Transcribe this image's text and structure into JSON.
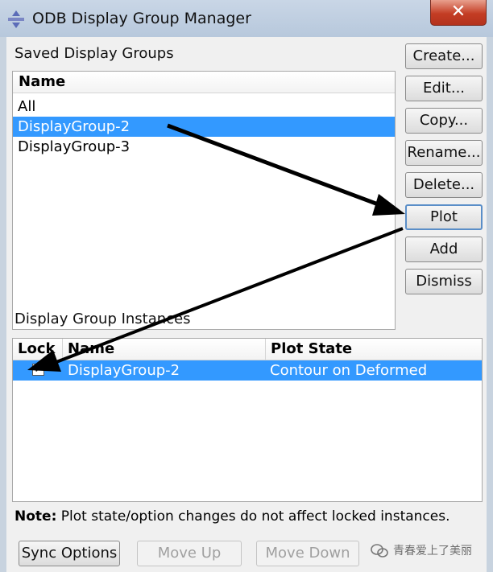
{
  "window": {
    "title": "ODB Display Group Manager",
    "close_glyph": "✕"
  },
  "saved": {
    "section_label": "Saved Display Groups",
    "column_header": "Name",
    "items": [
      "All",
      "DisplayGroup-2",
      "DisplayGroup-3"
    ],
    "selected_index": 1
  },
  "buttons": {
    "create": "Create...",
    "edit": "Edit...",
    "copy": "Copy...",
    "rename": "Rename...",
    "delete": "Delete...",
    "plot": "Plot",
    "add": "Add",
    "dismiss": "Dismiss"
  },
  "instances": {
    "section_label": "Display Group Instances",
    "headers": {
      "lock": "Lock",
      "name": "Name",
      "plot_state": "Plot State"
    },
    "rows": [
      {
        "locked": true,
        "check_glyph": "✓",
        "name": "DisplayGroup-2",
        "plot_state": "Contour on Deformed"
      }
    ]
  },
  "note": {
    "prefix": "Note:",
    "text": "Plot state/option changes do not affect locked instances."
  },
  "bottom_buttons": {
    "sync": "Sync Options",
    "move_up": "Move Up",
    "move_down": "Move Down"
  },
  "watermark": {
    "text": "青春爱上了美丽"
  },
  "colors": {
    "selection": "#3399ff",
    "close_button": "#c43d24",
    "annotation_arrow": "#000000"
  }
}
